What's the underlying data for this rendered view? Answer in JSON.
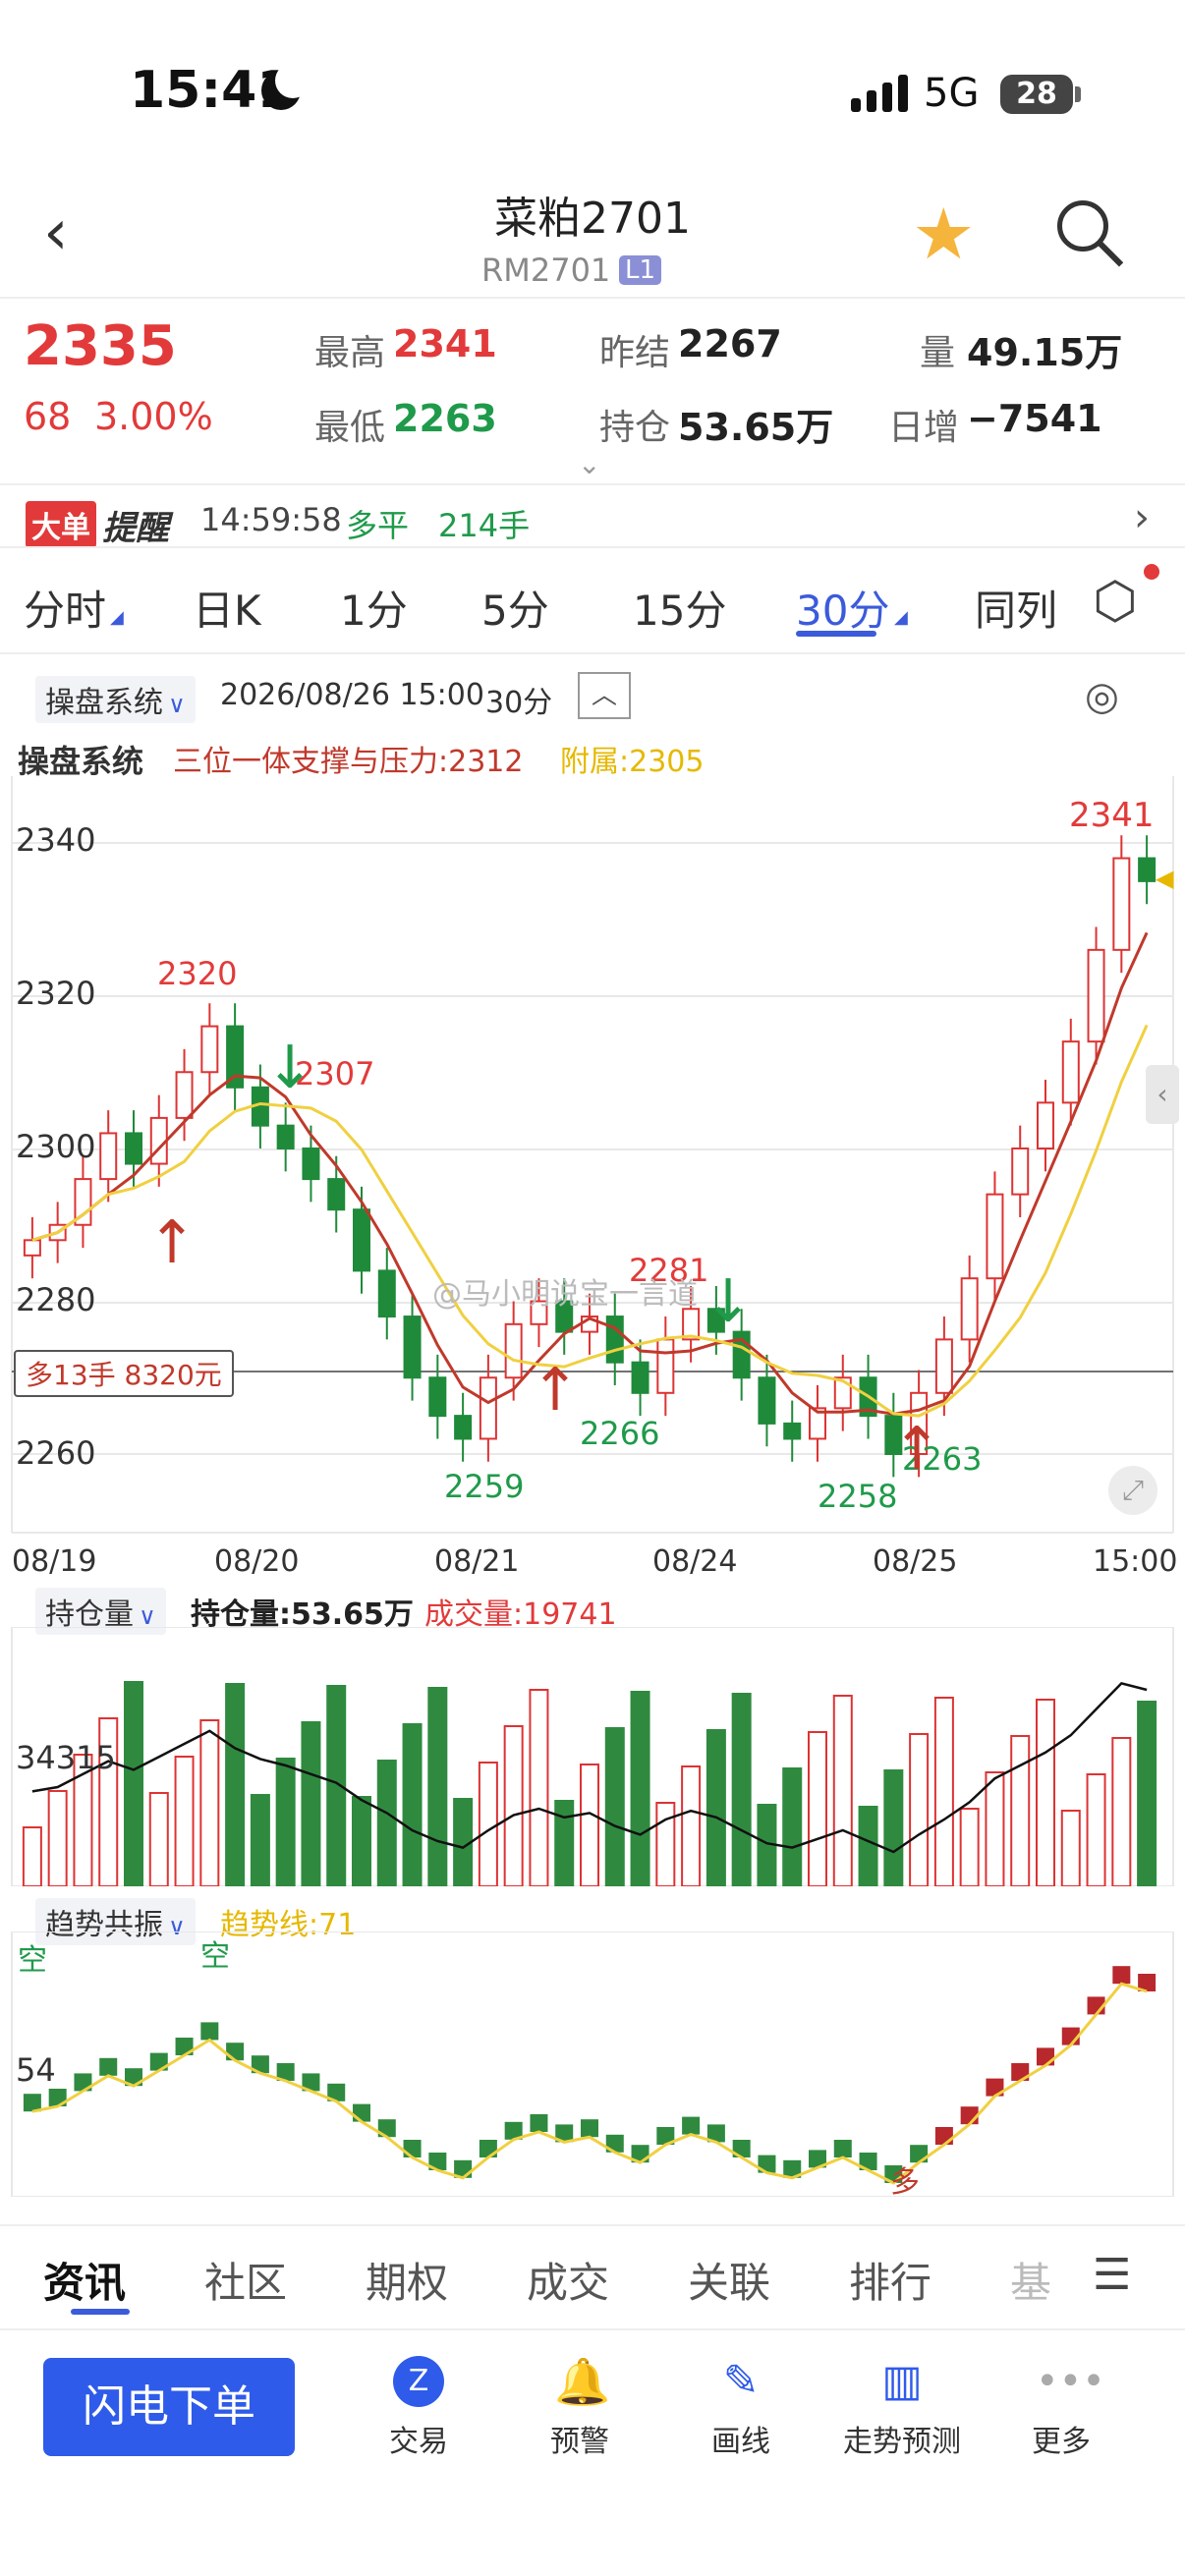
{
  "status": {
    "time": "15:41",
    "network": "5G",
    "battery": "28"
  },
  "header": {
    "title": "菜粕2701",
    "code": "RM2701",
    "badge": "L1"
  },
  "quote": {
    "last": "2335",
    "change": "68",
    "change_pct": "3.00%",
    "high_label": "最高",
    "high": "2341",
    "low_label": "最低",
    "low": "2263",
    "prev_settle_label": "昨结",
    "prev_settle": "2267",
    "oi_label": "持仓",
    "oi": "53.65万",
    "vol_label": "量",
    "vol": "49.15万",
    "daily_inc_label": "日增",
    "daily_inc": "−7541"
  },
  "big_order": {
    "badge": "大单",
    "title": "提醒",
    "time": "14:59:58",
    "type": "多平",
    "lots": "214手"
  },
  "period_tabs": [
    "分时",
    "日K",
    "1分",
    "5分",
    "15分",
    "30分",
    "同列"
  ],
  "active_tab": "30分",
  "chart_header": {
    "system": "操盘系统",
    "datetime": "2026/08/26 15:00",
    "period": "30分"
  },
  "indicator": {
    "name": "操盘系统",
    "support_label": "三位一体支撑与压力:2312",
    "aux_label": "附属:2305"
  },
  "main_chart": {
    "y_ticks": [
      "2340",
      "2320",
      "2300",
      "2280",
      "2260"
    ],
    "x_ticks": [
      "08/19",
      "08/20",
      "08/21",
      "08/24",
      "08/25",
      "15:00"
    ],
    "annotations": [
      "2320",
      "2307",
      "2281",
      "2341",
      "2266",
      "2259",
      "2258",
      "2263"
    ],
    "position_label": "多13手 8320元",
    "watermark": "@马小明说宝一言道"
  },
  "oi_panel": {
    "selector": "持仓量",
    "oi_text": "持仓量:53.65万",
    "vol_text": "成交量:19741",
    "y_tick": "34315"
  },
  "trend_panel": {
    "selector": "趋势共振",
    "trend_text": "趋势线:71",
    "y_tick": "54",
    "labels": [
      "空",
      "空",
      "多"
    ]
  },
  "bottom_tabs": [
    "资讯",
    "社区",
    "期权",
    "成交",
    "关联",
    "排行",
    "基"
  ],
  "toolbar": {
    "flash": "闪电下单",
    "items": [
      "交易",
      "预警",
      "画线",
      "走势预测",
      "更多"
    ]
  },
  "chart_data": {
    "type": "candlestick",
    "ylim": [
      2255,
      2345
    ],
    "x": [
      "08/19",
      "08/20",
      "08/21",
      "08/24",
      "08/25",
      "15:00"
    ],
    "series": [
      {
        "name": "",
        "values": [
          2288,
          2290,
          2296,
          2302,
          2298,
          2304,
          2310,
          2316,
          2308,
          2303,
          2300,
          2296,
          2292,
          2284,
          2278,
          2270,
          2265,
          2262,
          2270,
          2277,
          2280,
          2276,
          2278,
          2272,
          2268,
          2275,
          2279,
          2276,
          2270,
          2264,
          2262,
          2266,
          2270,
          2265,
          2260,
          2268,
          2275,
          2283,
          2294,
          2300,
          2306,
          2314,
          2326,
          2338,
          2335
        ]
      }
    ]
  }
}
